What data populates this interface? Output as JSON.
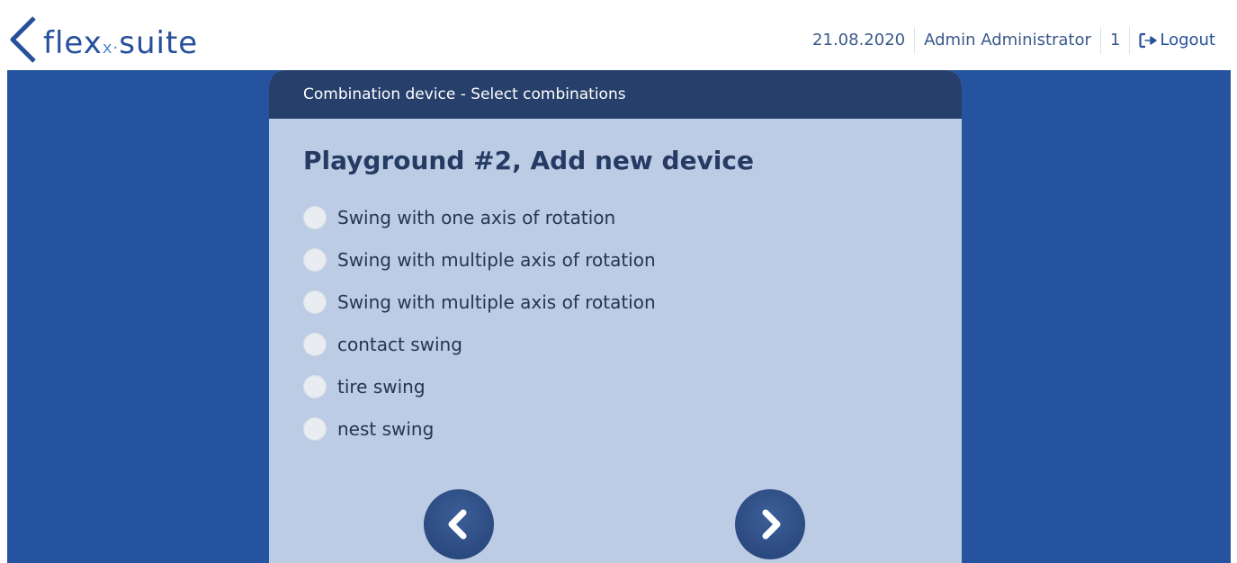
{
  "header": {
    "logo_text_main": "flex",
    "logo_text_x": "x·",
    "logo_text_suite": "suite",
    "date": "21.08.2020",
    "user": "Admin Administrator",
    "count": "1",
    "logout_label": "Logout"
  },
  "card": {
    "header_title": "Combination device - Select combinations",
    "title": "Playground #2, Add new device",
    "options": [
      {
        "label": "Swing with one axis of rotation"
      },
      {
        "label": "Swing with multiple axis of rotation"
      },
      {
        "label": "Swing with multiple axis of rotation"
      },
      {
        "label": "contact swing"
      },
      {
        "label": "tire swing"
      },
      {
        "label": "nest swing"
      }
    ]
  },
  "icons": {
    "logo": "flexx-suite-logo-icon",
    "logout": "sign-out-icon",
    "prev": "chevron-left-icon",
    "next": "chevron-right-icon"
  },
  "colors": {
    "brand": "#27509b",
    "stage_bg": "#2653a0",
    "card_bg": "#bccce5",
    "card_header_bg": "#273f6b",
    "title_text": "#263b63"
  }
}
